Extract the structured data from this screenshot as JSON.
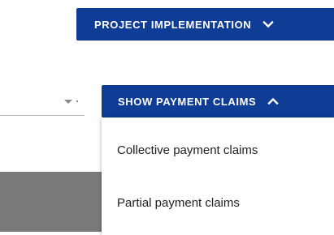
{
  "project_button": {
    "label": "PROJECT IMPLEMENTATION",
    "icon": "chevron-down-icon"
  },
  "payment_button": {
    "label": "SHOW PAYMENT CLAIMS",
    "icon": "chevron-up-icon"
  },
  "payment_menu": {
    "items": [
      {
        "label": "Collective payment claims"
      },
      {
        "label": "Partial payment claims"
      }
    ]
  },
  "colors": {
    "primary": "#0f3c94",
    "menu_text": "#212121",
    "background": "#ffffff"
  }
}
